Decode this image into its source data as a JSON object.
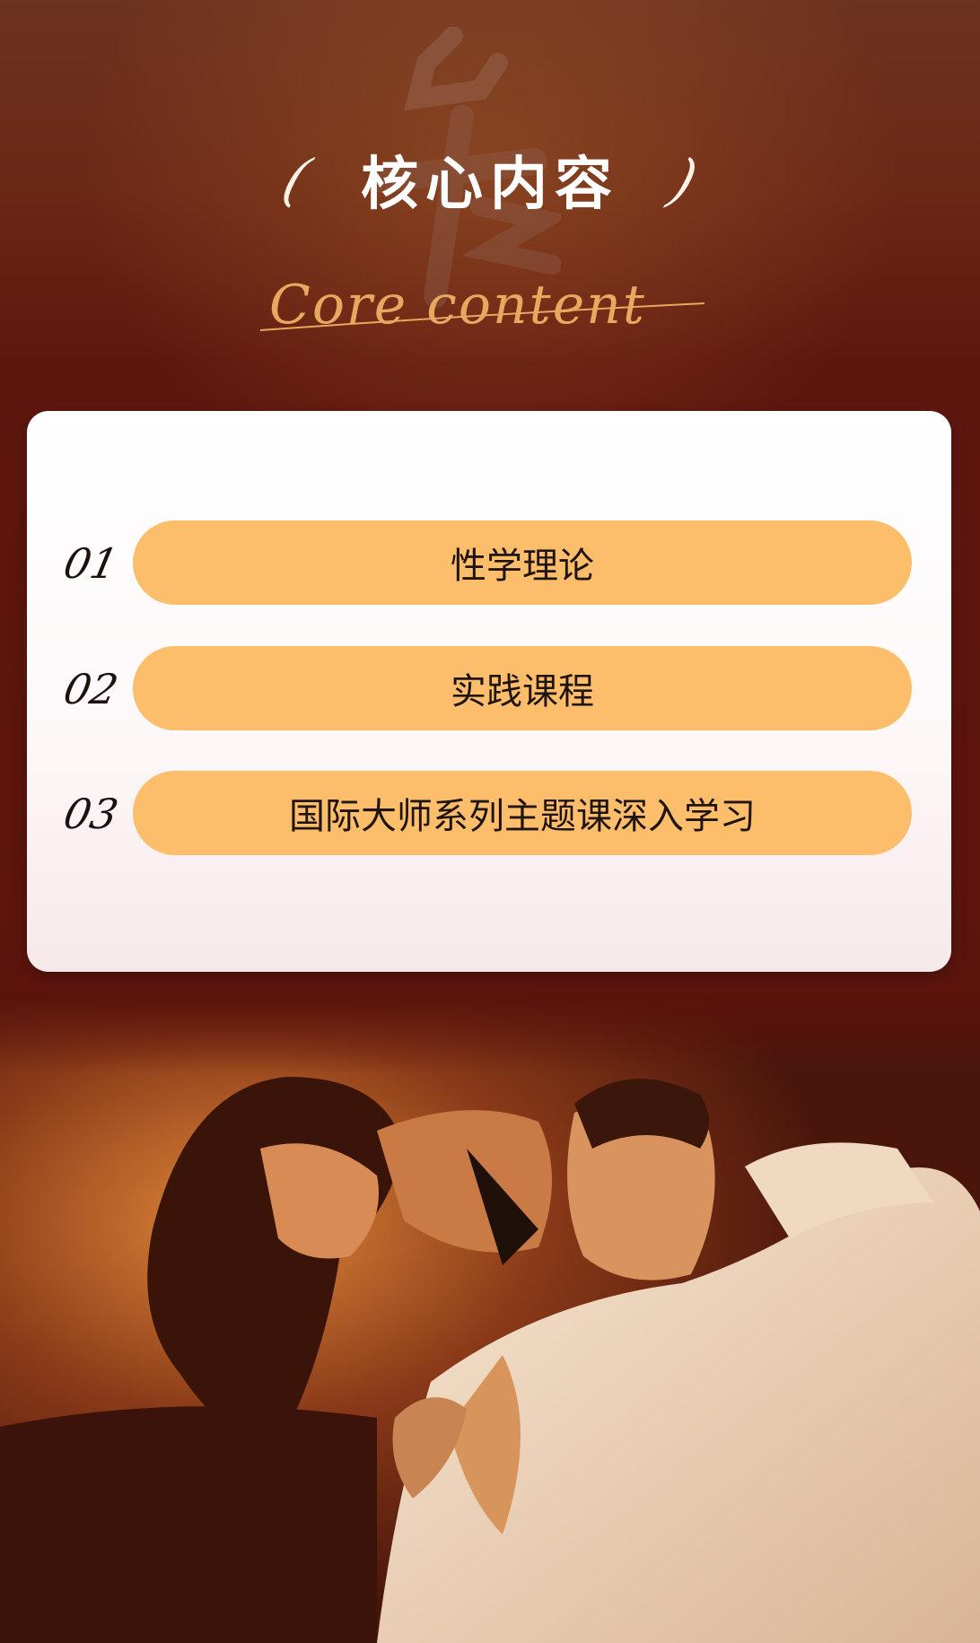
{
  "header": {
    "paren_left": "(",
    "title": "核心内容",
    "paren_right": ")",
    "subtitle_script": "Core content"
  },
  "items": [
    {
      "num": "01",
      "label": "性学理论"
    },
    {
      "num": "02",
      "label": "实践课程"
    },
    {
      "num": "03",
      "label": "国际大师系列主题课深入学习"
    }
  ],
  "colors": {
    "background": "#5a140d",
    "pill": "#fcbe6a",
    "accent_script": "#e8a85f",
    "card": "#ffffff"
  },
  "photo": {
    "icon": "couple-photo"
  }
}
